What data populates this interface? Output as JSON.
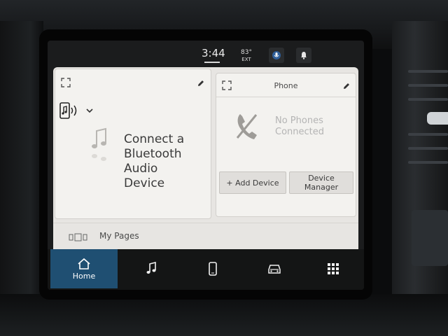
{
  "status_bar": {
    "time": "3:44",
    "temperature": "83°",
    "temperature_label": "EXT"
  },
  "audio_card": {
    "source_icon": "phone-audio-icon",
    "message": "Connect a Bluetooth Audio Device"
  },
  "phone_card": {
    "title": "Phone",
    "status": "No Phones Connected",
    "add_device_label": "+ Add Device",
    "device_manager_label": "Device Manager"
  },
  "my_pages": {
    "label": "My Pages"
  },
  "bottom_nav": {
    "items": [
      {
        "label": "Home",
        "icon": "home-icon",
        "active": true
      },
      {
        "label": "",
        "icon": "music-note-icon"
      },
      {
        "label": "",
        "icon": "phone-icon"
      },
      {
        "label": "",
        "icon": "vehicle-icon"
      },
      {
        "label": "",
        "icon": "apps-grid-icon"
      }
    ]
  },
  "colors": {
    "accent": "#1f4f72",
    "card_bg": "#f3f2ef",
    "nav_bg": "#141515"
  }
}
